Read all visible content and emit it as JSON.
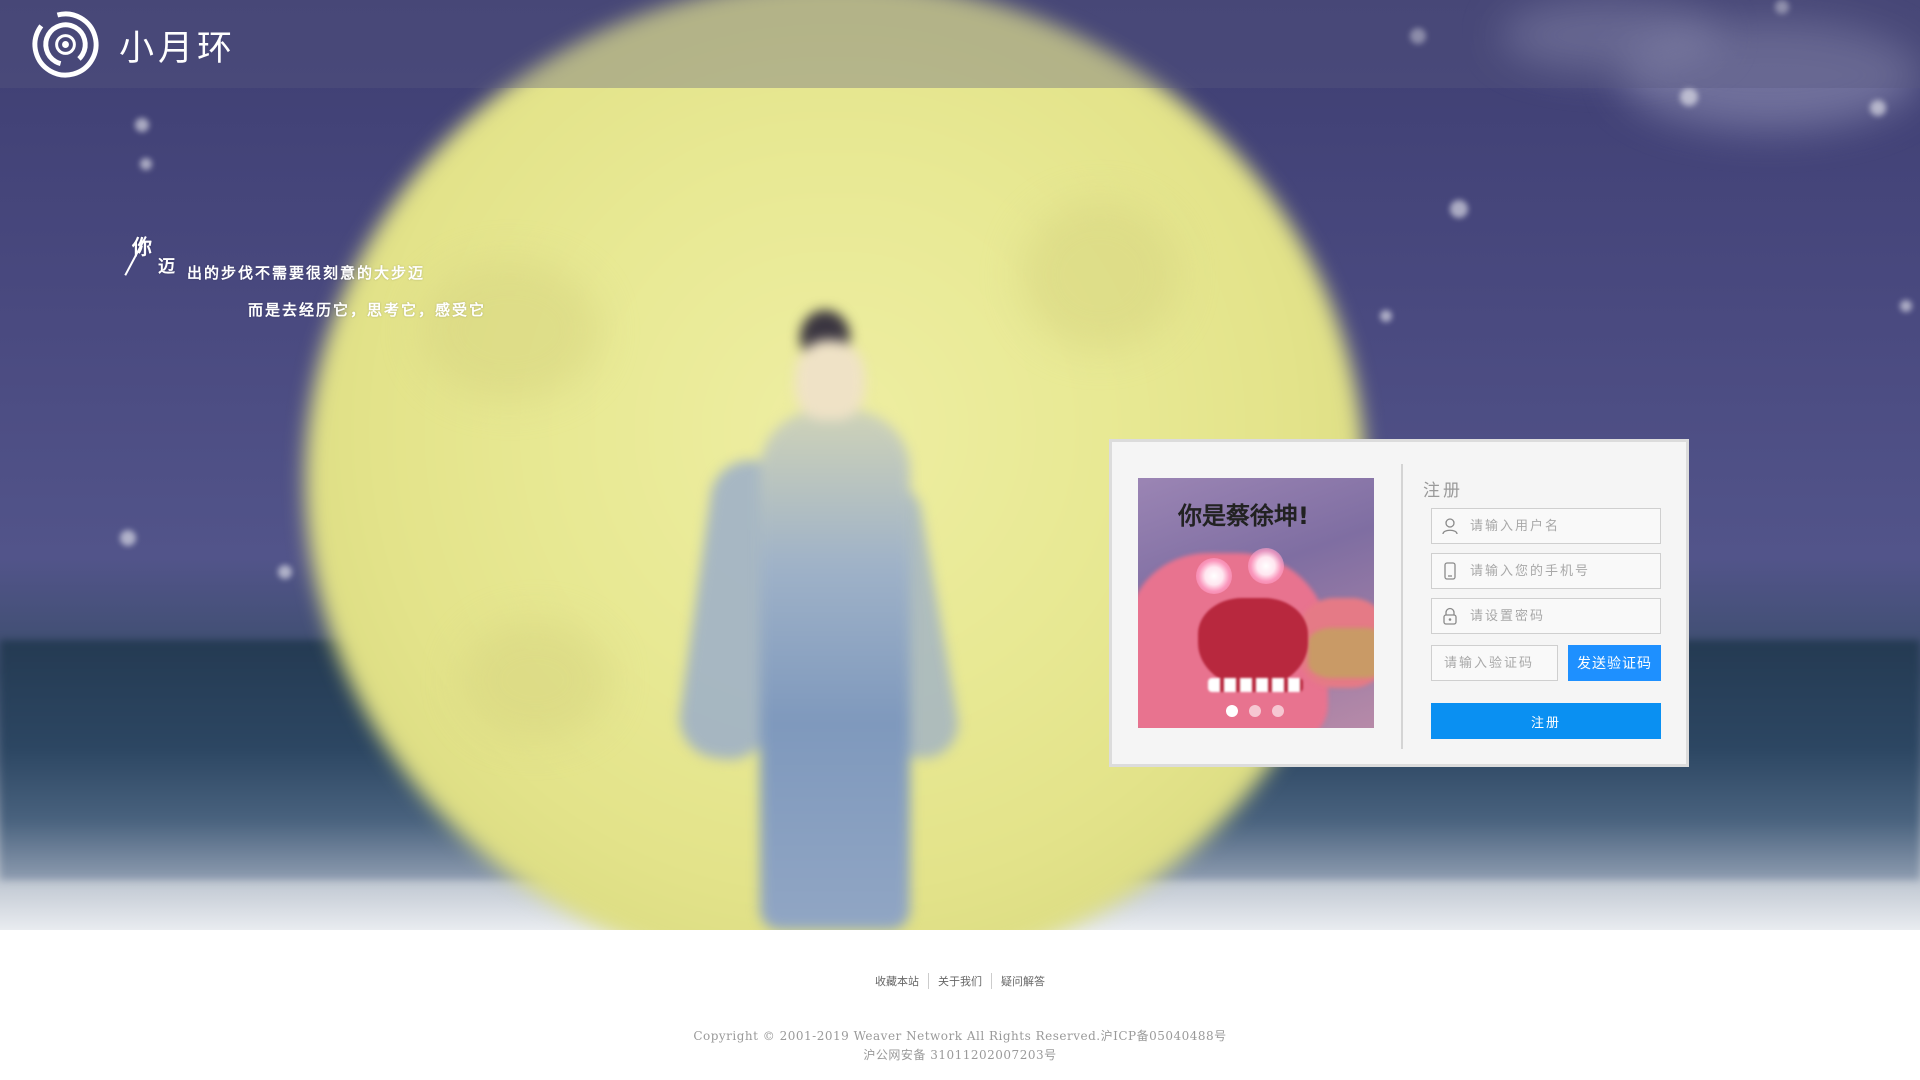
{
  "header": {
    "site_name": "小月环"
  },
  "slogan": {
    "char_ni": "你",
    "char_mai": "迈",
    "line1": "出的步伐不需要很刻意的大步迈",
    "line2": "而是去经历它，思考它，感受它"
  },
  "carousel": {
    "caption": "你是蔡徐坤!",
    "dots": 3,
    "active_dot": 0
  },
  "register_form": {
    "title": "注册",
    "username_placeholder": "请输入用户名",
    "phone_placeholder": "请输入您的手机号",
    "password_placeholder": "请设置密码",
    "code_placeholder": "请输入验证码",
    "send_code_label": "发送验证码",
    "submit_label": "注册",
    "accent_color": "#1e90ff"
  },
  "icons": {
    "logo": "moon-ring-logo-icon",
    "username": "user-icon",
    "phone": "phone-icon",
    "password": "lock-icon"
  },
  "footer": {
    "links": [
      "收藏本站",
      "关于我们",
      "疑问解答"
    ],
    "copyright": "Copyright © 2001-2019 Weaver Network All Rights Reserved.沪ICP备05040488号",
    "beian": "沪公网安备 31011202007203号"
  }
}
